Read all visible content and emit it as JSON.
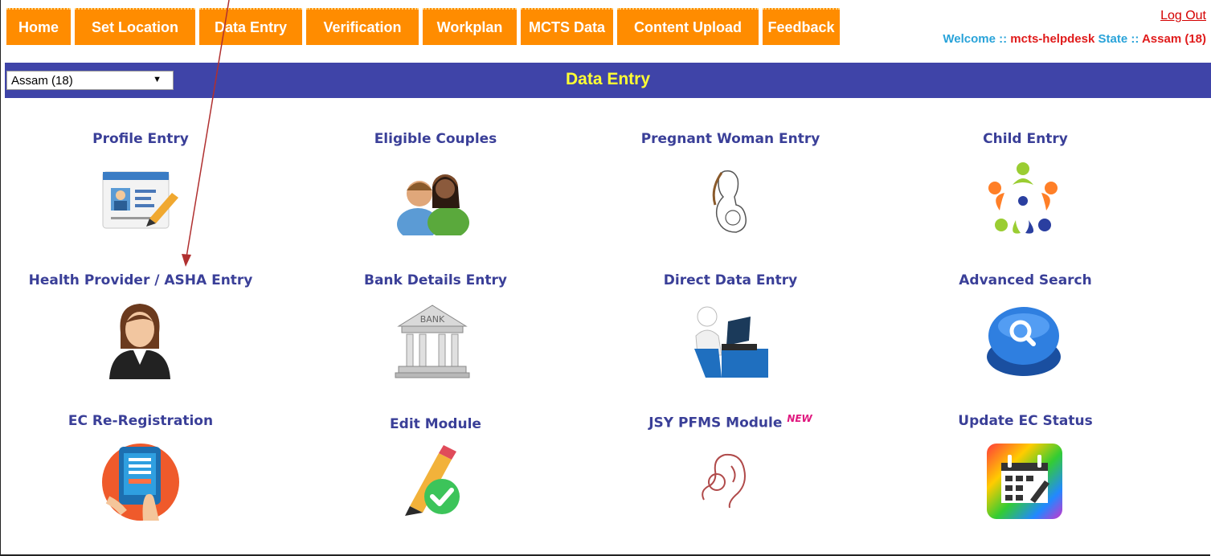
{
  "nav": {
    "tabs": [
      "Home",
      "Set Location",
      "Data Entry",
      "Verification",
      "Workplan",
      "MCTS Data",
      "Content Upload",
      "Feedback"
    ],
    "logout": "Log Out",
    "welcome_label": "Welcome ::",
    "user": "mcts-helpdesk",
    "state_label": "State ::",
    "state": "Assam (18)"
  },
  "header": {
    "state_select": "Assam (18)",
    "title": "Data Entry"
  },
  "modules": [
    {
      "label": "Profile Entry",
      "icon": "profile-card-icon"
    },
    {
      "label": "Eligible Couples",
      "icon": "couple-icon"
    },
    {
      "label": "Pregnant Woman Entry",
      "icon": "pregnant-woman-icon"
    },
    {
      "label": "Child Entry",
      "icon": "children-circle-icon"
    },
    {
      "label": "Health Provider / ASHA Entry",
      "icon": "woman-provider-icon"
    },
    {
      "label": "Bank Details Entry",
      "icon": "bank-icon"
    },
    {
      "label": "Direct Data Entry",
      "icon": "person-laptop-icon"
    },
    {
      "label": "Advanced Search",
      "icon": "search-button-icon"
    },
    {
      "label": "EC Re-Registration",
      "icon": "tablet-form-icon"
    },
    {
      "label": "Edit Module",
      "icon": "pencil-check-icon"
    },
    {
      "label": "JSY PFMS Module",
      "icon": "mother-child-icon"
    },
    {
      "label": "Update EC Status",
      "icon": "calendar-icon"
    }
  ],
  "new_badge": "NEW",
  "colors": {
    "nav_orange": "#ff8c00",
    "bar_blue": "#3f44a8",
    "title_yellow": "#ffff33",
    "label_blue": "#3a3f98"
  }
}
